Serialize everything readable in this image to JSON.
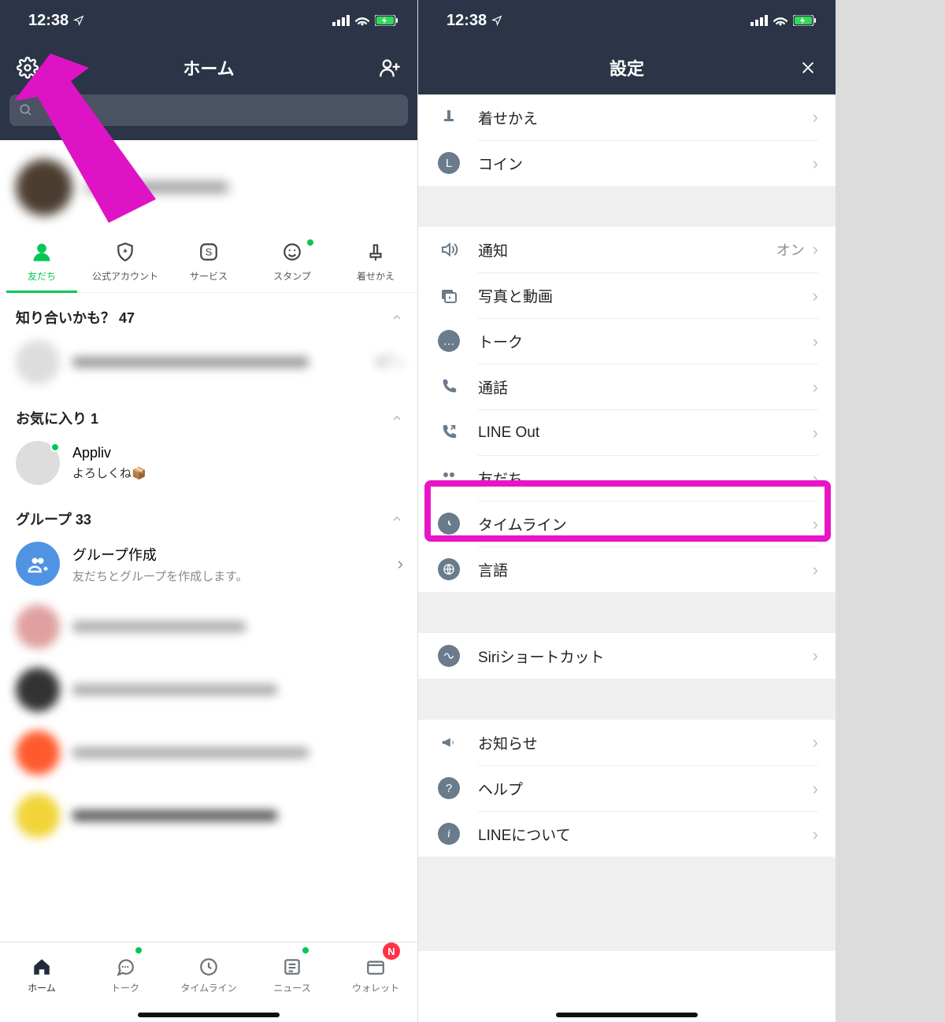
{
  "statusbar": {
    "time": "12:38"
  },
  "left": {
    "nav": {
      "title": "ホーム"
    },
    "tabs": {
      "friends": "友だち",
      "official": "公式アカウント",
      "service": "サービス",
      "stamp": "スタンプ",
      "theme": "着せかえ"
    },
    "sections": {
      "suggestions": {
        "header": "知り合いかも？ 47",
        "count": "47"
      },
      "favorites": {
        "header": "お気に入り 1",
        "items": [
          {
            "name": "Appliv",
            "sub": "よろしくね📦"
          }
        ]
      },
      "groups": {
        "header": "グループ 33",
        "create": {
          "title": "グループ作成",
          "sub": "友だちとグループを作成します。"
        }
      }
    },
    "bottom": {
      "home": "ホーム",
      "talk": "トーク",
      "timeline": "タイムライン",
      "news": "ニュース",
      "wallet": "ウォレット",
      "wallet_badge": "N"
    }
  },
  "right": {
    "nav": {
      "title": "設定"
    },
    "items": {
      "theme": "着せかえ",
      "coin": "コイン",
      "notification": "通知",
      "notification_value": "オン",
      "photovideo": "写真と動画",
      "talk": "トーク",
      "call": "通話",
      "lineout": "LINE Out",
      "friends": "友だち",
      "timeline": "タイムライン",
      "language": "言語",
      "siri": "Siriショートカット",
      "announcement": "お知らせ",
      "help": "ヘルプ",
      "about": "LINEについて"
    }
  }
}
